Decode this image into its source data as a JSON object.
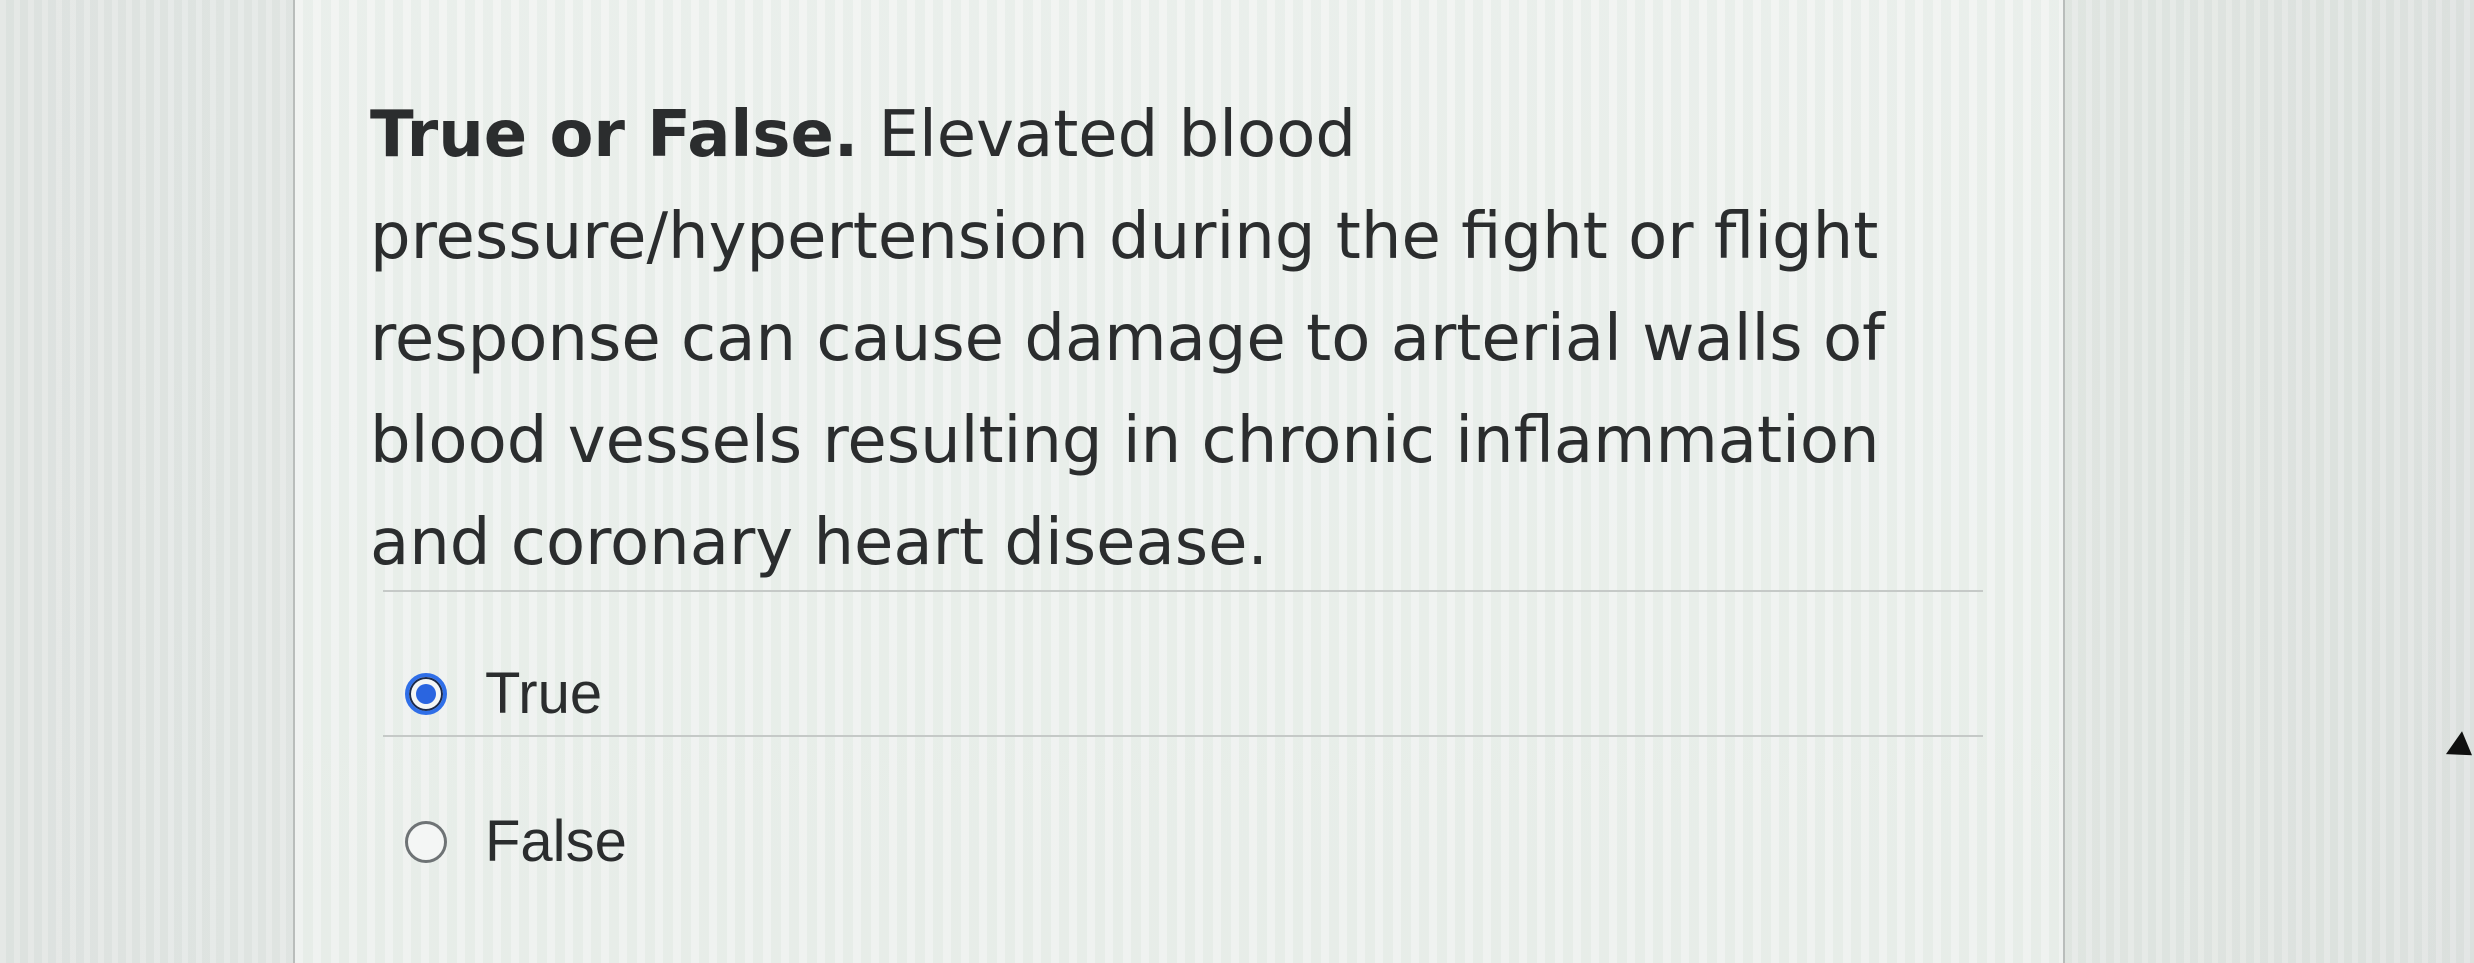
{
  "question": {
    "lead": "True or False.",
    "text": "Elevated blood pressure/hypertension during the fight or flight response can cause damage to arterial walls of blood vessels resulting in chronic inflammation and coronary heart disease."
  },
  "options": [
    {
      "label": "True",
      "selected": true
    },
    {
      "label": "False",
      "selected": false
    }
  ],
  "colors": {
    "selected_radio": "#2a65e0",
    "text": "#2b2d2e"
  }
}
